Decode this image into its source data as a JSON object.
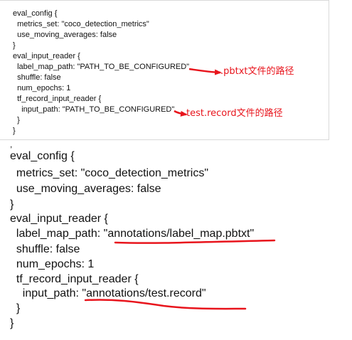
{
  "small_code": {
    "lines": [
      "eval_config {",
      "  metrics_set: \"coco_detection_metrics\"",
      "  use_moving_averages: false",
      "}",
      "eval_input_reader {",
      "  label_map_path: \"PATH_TO_BE_CONFIGURED\"",
      "  shuffle: false",
      "  num_epochs: 1",
      "  tf_record_input_reader {",
      "    input_path: \"PATH_TO_BE_CONFIGURED\"",
      "  }",
      "}"
    ]
  },
  "annotations": {
    "pbtxt_note": ".pbtxt文件的路径",
    "record_note": "test.record文件的路径"
  },
  "separator": ",",
  "big_code": {
    "lines": [
      "eval_config {",
      "  metrics_set: \"coco_detection_metrics\"",
      "  use_moving_averages: false",
      "}",
      "eval_input_reader {",
      "  label_map_path: \"annotations/label_map.pbtxt\"",
      "  shuffle: false",
      "  num_epochs: 1",
      "  tf_record_input_reader {",
      "    input_path: \"annotations/test.record\"",
      "  }",
      "}"
    ]
  },
  "colors": {
    "annotation_red": "#e8141c",
    "text": "#111111"
  }
}
